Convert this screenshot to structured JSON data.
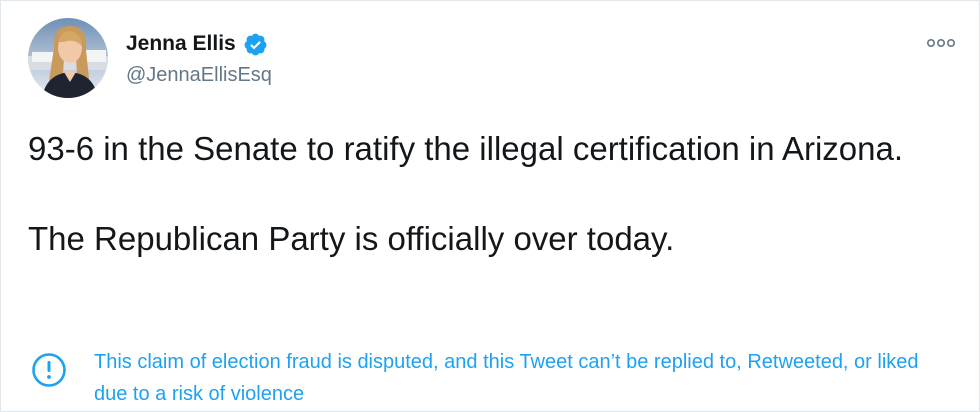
{
  "author": {
    "display_name": "Jenna Ellis",
    "handle": "@JennaEllisEsq",
    "verified": true,
    "avatar": "profile-photo"
  },
  "tweet": {
    "paragraph_1": "93-6 in the Senate to ratify the illegal certification in Arizona.",
    "paragraph_2": "The Republican Party is officially over today."
  },
  "notice": {
    "icon": "exclamation-circle-icon",
    "text": "This claim of election fraud is disputed, and this Tweet can’t be replied to, Retweeted, or liked due to a risk of violence"
  },
  "colors": {
    "accent": "#1da1f2",
    "text": "#14171a",
    "secondary_text": "#657786"
  }
}
